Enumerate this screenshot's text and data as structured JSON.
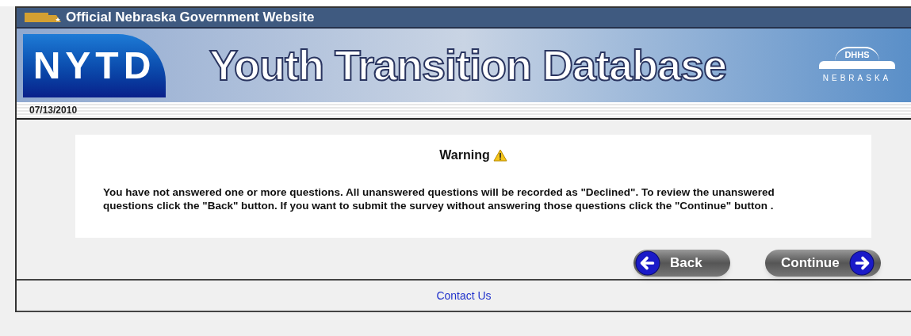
{
  "gov_bar": {
    "title": "Official Nebraska Government Website"
  },
  "banner": {
    "logo": "NYTD",
    "title": "Youth Transition Database",
    "agency": "DHHS",
    "state": "NEBRASKA"
  },
  "date": "07/13/2010",
  "warning": {
    "title": "Warning",
    "message": "You have not answered one or more questions. All unanswered questions will be recorded as \"Declined\". To review the unanswered questions click the \"Back\" button. If you want to submit the survey without answering those questions click the \"Continue\" button ."
  },
  "buttons": [
    {
      "label": "Back",
      "kind": "back"
    },
    {
      "label": "Continue",
      "kind": "next"
    }
  ],
  "footer": {
    "link": "Contact Us"
  }
}
